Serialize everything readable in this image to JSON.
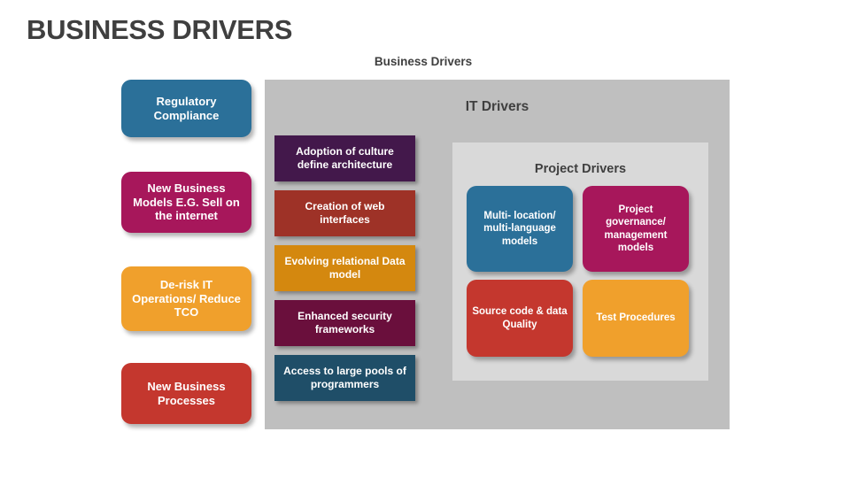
{
  "slide": {
    "title": "BUSINESS DRIVERS",
    "title_color": "#3f3f3f",
    "background": "#ffffff"
  },
  "captions": {
    "business_drivers": "Business Drivers",
    "it_drivers": "IT Drivers",
    "project_drivers": "Project Drivers"
  },
  "panels": {
    "it_drivers_bg": "#bfbfbf",
    "project_drivers_bg": "#d9d9d9"
  },
  "palette": {
    "blue": "#2b7099",
    "magenta": "#a7175b",
    "orange": "#f0a02c",
    "red": "#c4372e",
    "dark_purple": "#43184b",
    "brick": "#9e3227",
    "dark_orange": "#d4880f",
    "plum": "#6a0f3c",
    "teal_dark": "#1f4e68"
  },
  "business_drivers": {
    "items": [
      {
        "label": "Regulatory Compliance",
        "color": "#2b7099"
      },
      {
        "label": "New Business Models E.G. Sell on the internet",
        "color": "#a7175b"
      },
      {
        "label": "De-risk IT Operations/ Reduce TCO",
        "color": "#f0a02c"
      },
      {
        "label": "New Business Processes",
        "color": "#c4372e"
      }
    ]
  },
  "it_drivers": {
    "items": [
      {
        "label": "Adoption of culture define architecture",
        "color": "#43184b"
      },
      {
        "label": "Creation of web interfaces",
        "color": "#9e3227"
      },
      {
        "label": "Evolving relational Data model",
        "color": "#d4880f"
      },
      {
        "label": "Enhanced security frameworks",
        "color": "#6a0f3c"
      },
      {
        "label": "Access to large pools of programmers",
        "color": "#1f4e68"
      }
    ]
  },
  "project_drivers": {
    "items": [
      {
        "label": "Multi- location/ multi-language models",
        "color": "#2b7099"
      },
      {
        "label": "Project governance/ management models",
        "color": "#a7175b"
      },
      {
        "label": "Source code & data Quality",
        "color": "#c4372e"
      },
      {
        "label": "Test Procedures",
        "color": "#f0a02c"
      }
    ]
  }
}
